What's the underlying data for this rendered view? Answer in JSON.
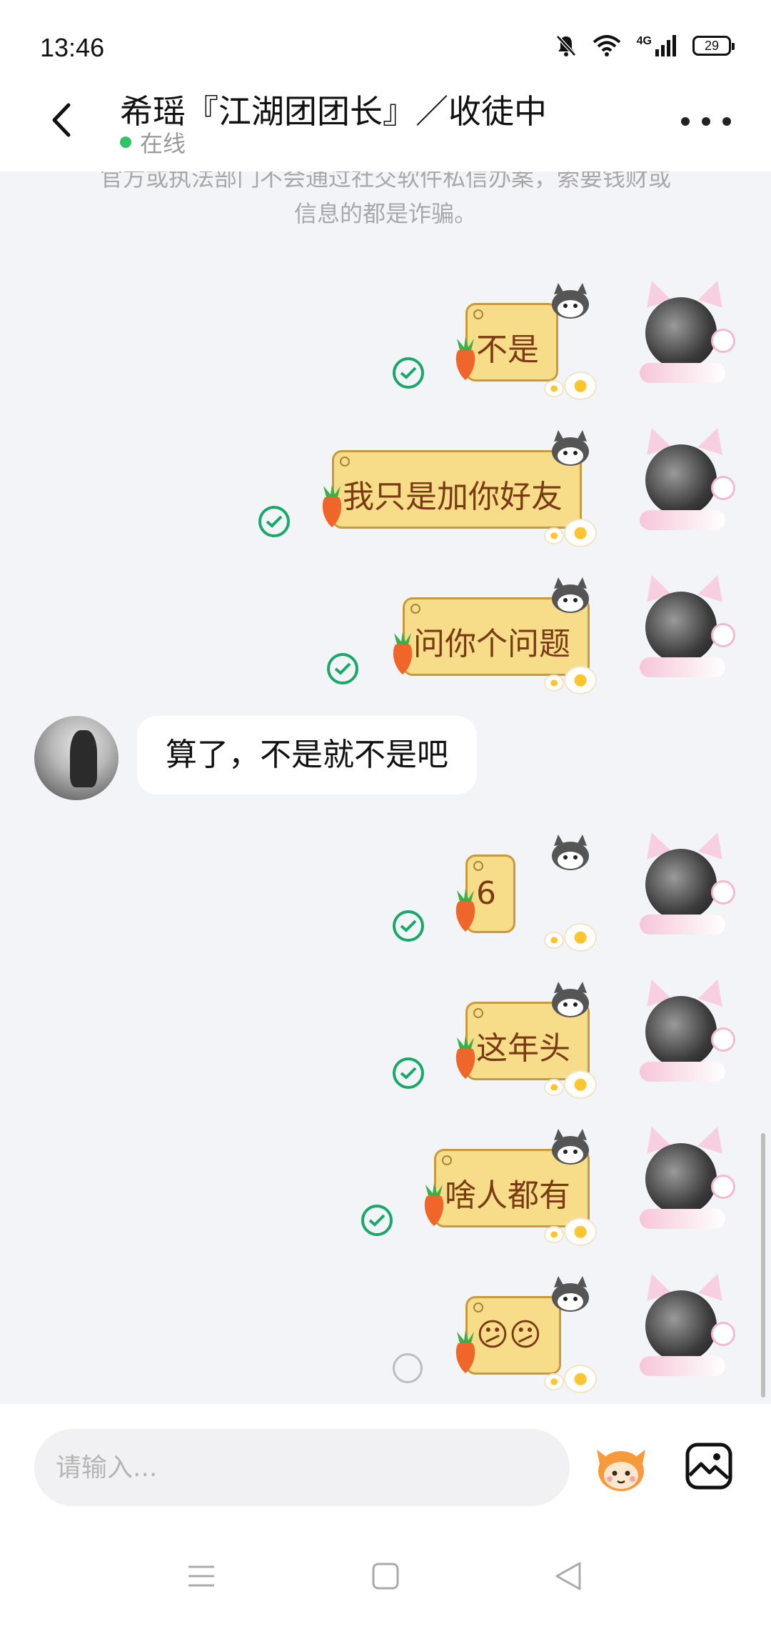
{
  "status_bar": {
    "time": "13:46",
    "network_label": "4G",
    "battery": "29"
  },
  "header": {
    "title": "希瑶『江湖团团长』／收徒中",
    "online_status": "在线"
  },
  "notice": {
    "line1": "官方或执法部门不会通过社交软件私信办案，索要钱财或",
    "line2": "信息的都是诈骗。"
  },
  "messages": [
    {
      "side": "me",
      "text": "不是",
      "status": "sent"
    },
    {
      "side": "me",
      "text": "我只是加你好友",
      "status": "sent"
    },
    {
      "side": "me",
      "text": "问你个问题",
      "status": "sent"
    },
    {
      "side": "them",
      "text": "算了，不是就不是吧"
    },
    {
      "side": "me",
      "text": "6",
      "status": "sent"
    },
    {
      "side": "me",
      "text": "这年头",
      "status": "sent"
    },
    {
      "side": "me",
      "text": "啥人都有",
      "status": "sent"
    },
    {
      "side": "me",
      "text": "😕😕",
      "status": "pending"
    }
  ],
  "input": {
    "placeholder": "请输入..."
  },
  "icons": {
    "back": "chevron-left-icon",
    "more": "more-dots-icon",
    "emoji": "emoji-mascot-icon",
    "image": "image-icon",
    "nav_menu": "menu-icon",
    "nav_home": "home-square-icon",
    "nav_back": "back-triangle-icon"
  },
  "colors": {
    "online": "#2ec46a",
    "sent_check": "#1aa86a",
    "bubble_fill": "#f7dc8a",
    "bubble_text": "#7a3a12"
  }
}
